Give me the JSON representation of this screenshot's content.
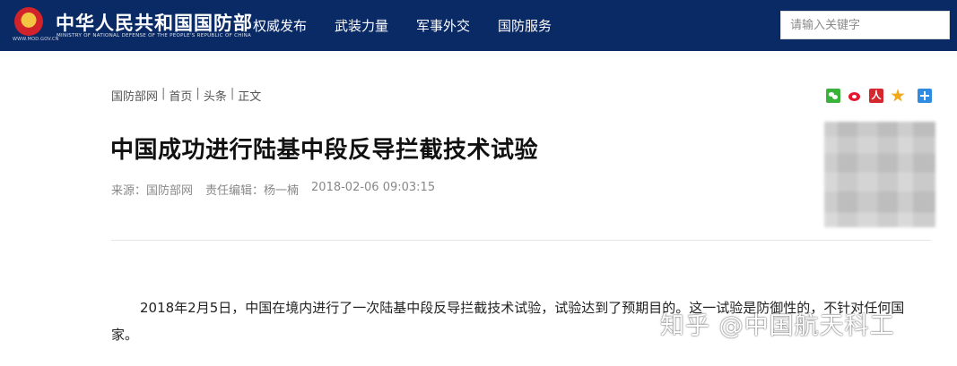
{
  "header": {
    "domain": "WWW.MOD.GOV.CN",
    "site_name": "中华人民共和国国防部",
    "site_name_en": "MINISTRY OF NATIONAL DEFENSE OF THE PEOPLE'S REPUBLIC OF CHINA",
    "nav": [
      {
        "label": "权威发布"
      },
      {
        "label": "武装力量"
      },
      {
        "label": "军事外交"
      },
      {
        "label": "国防服务"
      }
    ],
    "search": {
      "placeholder": "请输入关键字",
      "value": ""
    },
    "bg_color": "#0a2a66"
  },
  "breadcrumb": {
    "items": [
      "国防部网",
      "首页",
      "头条",
      "正文"
    ],
    "separator": "|"
  },
  "share": {
    "icons": [
      "wechat-icon",
      "weibo-icon",
      "renmin-icon",
      "favorite-icon",
      "more-icon"
    ],
    "renmin_glyph": "人"
  },
  "article": {
    "title": "中国成功进行陆基中段反导拦截技术试验",
    "source": "来源：国防部网",
    "editor": "责任编辑：杨一楠",
    "datetime": "2018-02-06 09:03:15",
    "paragraphs": [
      "2018年2月5日，中国在境内进行了一次陆基中段反导拦截技术试验，试验达到了预期目的。这一试验是防御性的，不针对任何国家。"
    ]
  },
  "watermark": "知乎 @中国航天科工"
}
